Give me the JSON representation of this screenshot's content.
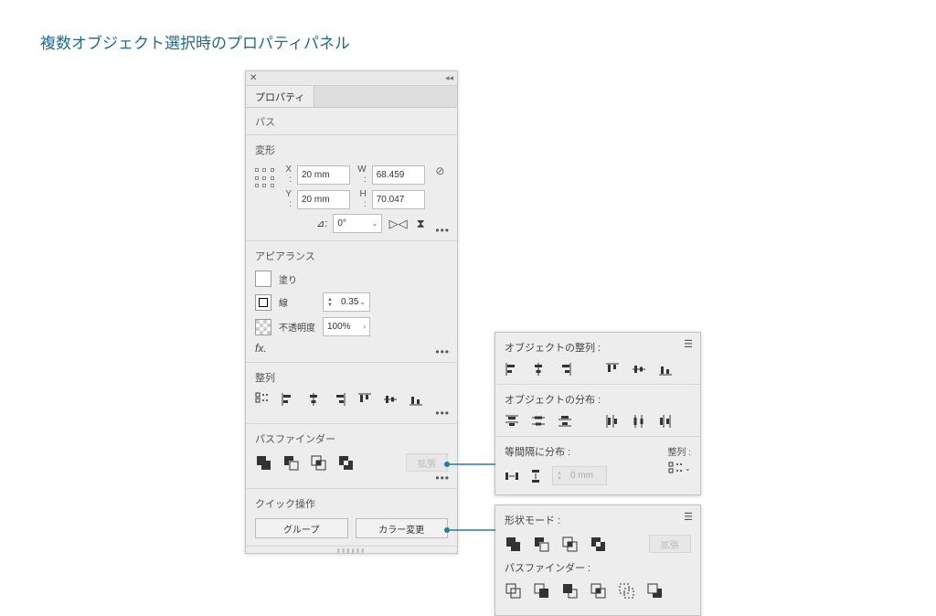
{
  "page_title": "複数オブジェクト選択時のプロパティパネル",
  "panel": {
    "tab": "プロパティ",
    "object_type": "パス",
    "transform": {
      "title": "変形",
      "x_label": "X :",
      "y_label": "Y :",
      "w_label": "W :",
      "h_label": "H :",
      "x": "20 mm",
      "y": "20 mm",
      "w": "68.459",
      "h": "70.047",
      "rotate_label": "⊿:",
      "rotate": "0°"
    },
    "appearance": {
      "title": "アピアランス",
      "fill_label": "塗り",
      "stroke_label": "線",
      "stroke_value": "0.35",
      "opacity_label": "不透明度",
      "opacity_value": "100%",
      "fx": "fx."
    },
    "align": {
      "title": "整列"
    },
    "pathfinder": {
      "title": "パスファインダー",
      "expand": "拡張"
    },
    "quick": {
      "title": "クイック操作",
      "group": "グループ",
      "recolor": "カラー変更"
    }
  },
  "popout_align": {
    "align_title": "オブジェクトの整列 :",
    "dist_title": "オブジェクトの分布 :",
    "spacing_title": "等間隔に分布 :",
    "spacing_value": "0 mm",
    "align_to_label": "整列 :"
  },
  "popout_pf": {
    "shape_mode_title": "形状モード :",
    "expand": "拡張",
    "pathfinder_title": "パスファインダー :"
  }
}
